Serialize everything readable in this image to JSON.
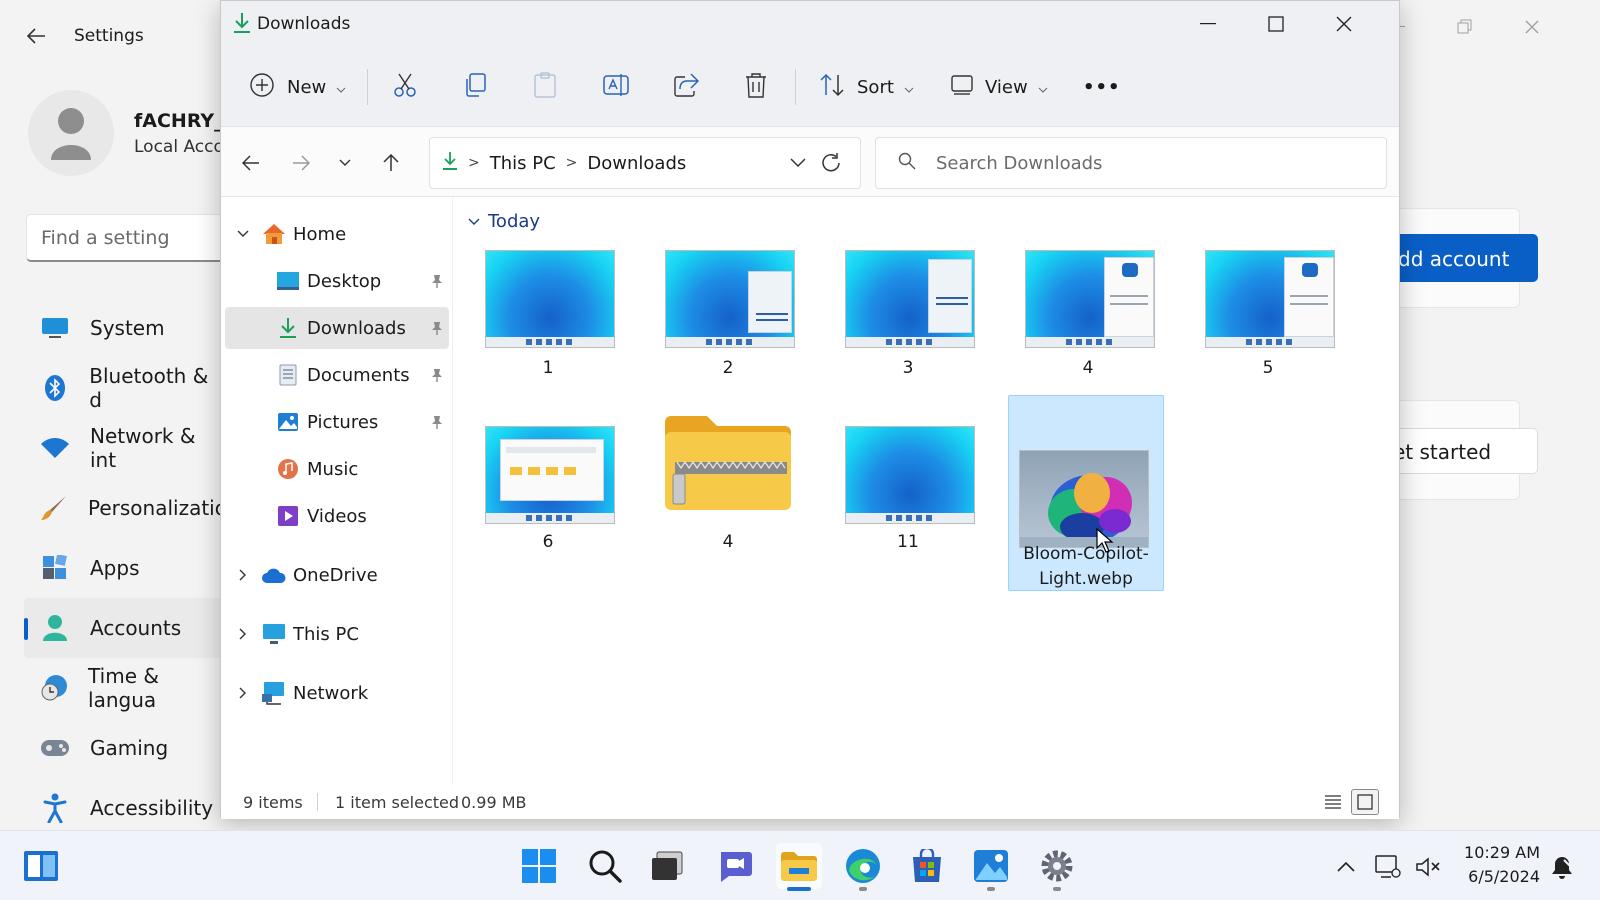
{
  "settings": {
    "title": "Settings",
    "user_name": "fACHRY_",
    "account_type": "Local Acco",
    "search_placeholder": "Find a setting",
    "nav": [
      {
        "label": "System",
        "icon": "monitor-icon"
      },
      {
        "label": "Bluetooth & d",
        "icon": "bluetooth-icon"
      },
      {
        "label": "Network & int",
        "icon": "wifi-icon"
      },
      {
        "label": "Personalizatio",
        "icon": "brush-icon"
      },
      {
        "label": "Apps",
        "icon": "apps-icon"
      },
      {
        "label": "Accounts",
        "icon": "accounts-icon",
        "active": true
      },
      {
        "label": "Time & langua",
        "icon": "clock-globe-icon"
      },
      {
        "label": "Gaming",
        "icon": "gamepad-icon"
      },
      {
        "label": "Accessibility",
        "icon": "accessibility-icon"
      }
    ],
    "add_account_label": "dd account",
    "get_started_label": "et started"
  },
  "explorer": {
    "title": "Downloads",
    "toolbar": {
      "new_label": "New",
      "sort_label": "Sort",
      "view_label": "View",
      "more_label": "•••"
    },
    "breadcrumb": [
      "This PC",
      "Downloads"
    ],
    "search_placeholder": "Search Downloads",
    "nav": {
      "home": "Home",
      "desktop": "Desktop",
      "downloads": "Downloads",
      "documents": "Documents",
      "pictures": "Pictures",
      "music": "Music",
      "videos": "Videos",
      "onedrive": "OneDrive",
      "this_pc": "This PC",
      "network": "Network"
    },
    "group_label": "Today",
    "files": [
      {
        "name": "1",
        "kind": "screenshot"
      },
      {
        "name": "2",
        "kind": "screenshot"
      },
      {
        "name": "3",
        "kind": "screenshot"
      },
      {
        "name": "4",
        "kind": "screenshot"
      },
      {
        "name": "5",
        "kind": "screenshot"
      },
      {
        "name": "6",
        "kind": "screenshot"
      },
      {
        "name": "4",
        "kind": "zip-folder"
      },
      {
        "name": "11",
        "kind": "screenshot"
      },
      {
        "name": "Bloom-Copilot-Light.webp",
        "kind": "image",
        "selected": true
      }
    ],
    "status": {
      "item_count": "9 items",
      "selection": "1 item selected",
      "size": "0.99 MB"
    }
  },
  "taskbar": {
    "time": "10:29 AM",
    "date": "6/5/2024"
  },
  "colors": {
    "accent": "#0a5fc7",
    "selection": "#cce8ff",
    "folder": "#f5c242"
  }
}
